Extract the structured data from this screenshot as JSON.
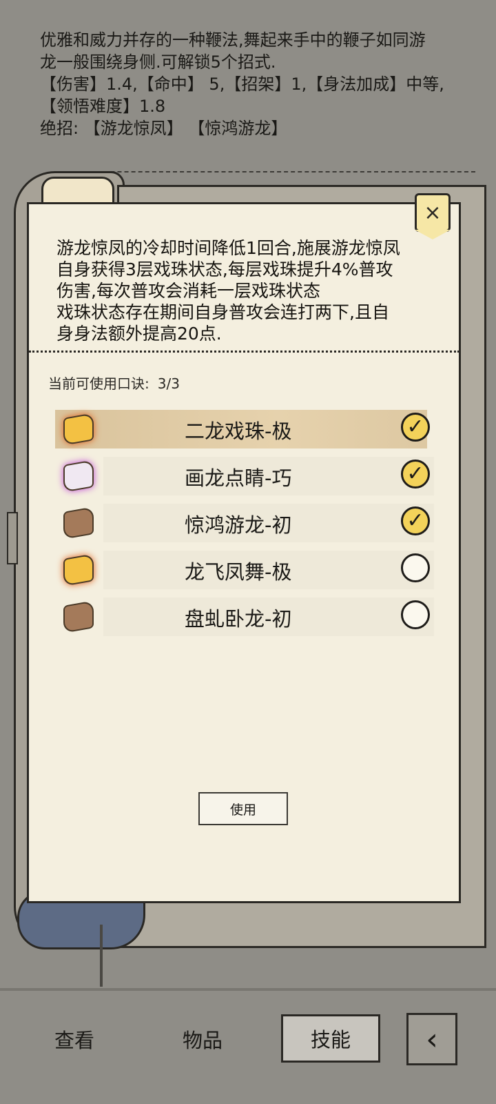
{
  "description": {
    "lines": [
      "优雅和威力并存的一种鞭法,舞起来手中的鞭子如同游",
      "龙一般围绕身侧.可解锁5个招式.",
      "【伤害】1.4,【命中】 5,【招架】1,【身法加成】中等,",
      "【领悟难度】1.8",
      "绝招:  【游龙惊凤】 【惊鸿游龙】"
    ]
  },
  "dialog": {
    "close_icon": "×",
    "effect_lines": [
      "游龙惊凤的冷却时间降低1回合,施展游龙惊凤",
      "自身获得3层戏珠状态,每层戏珠提升4%普攻",
      "伤害,每次普攻会消耗一层戏珠状态",
      "戏珠状态存在期间自身普攻会连打两下,且自",
      "身身法额外提高20点."
    ],
    "count_label": "当前可使用口诀:",
    "count_value": "3/3",
    "items": [
      {
        "name": "二龙戏珠-极",
        "icon": "scroll-gold-icon",
        "checked": true,
        "check": "✓"
      },
      {
        "name": "画龙点睛-巧",
        "icon": "scroll-purple-icon",
        "checked": true,
        "check": "✓"
      },
      {
        "name": "惊鸿游龙-初",
        "icon": "scroll-brown-icon",
        "checked": true,
        "check": "✓"
      },
      {
        "name": "龙飞凤舞-极",
        "icon": "scroll-gold-icon",
        "checked": false,
        "check": ""
      },
      {
        "name": "盘虬卧龙-初",
        "icon": "scroll-brown-icon",
        "checked": false,
        "check": ""
      }
    ],
    "use_label": "使用"
  },
  "nav": {
    "view": "查看",
    "items": "物品",
    "skills": "技能",
    "back_icon": "‹"
  }
}
